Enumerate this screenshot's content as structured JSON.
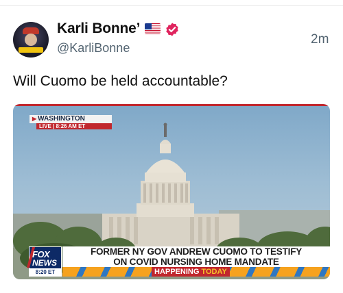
{
  "tweet": {
    "author": {
      "display_name": "Karli Bonne’",
      "handle": "@KarliBonne",
      "flag_emoji": "us-flag-icon",
      "verified": true,
      "verified_color": "#e0245e"
    },
    "timestamp": "2m",
    "text": "Will Cuomo be held accountable?"
  },
  "media": {
    "location_bug": {
      "city": "WASHINGTON",
      "live_line": "LIVE | 8:26 AM ET"
    },
    "network_logo": {
      "line1": "FOX",
      "line2": "NEWS",
      "time": "8:20 ET"
    },
    "headline": {
      "line1": "FORMER NY GOV ANDREW CUOMO TO TESTIFY",
      "line2": "ON COVID NURSING HOME MANDATE"
    },
    "ticker": {
      "tag": "HAPPENING",
      "tag_highlight": "TODAY"
    }
  },
  "colors": {
    "accent_red": "#c1272d",
    "fox_blue": "#0d2a66",
    "ticker_orange": "#f6a21e"
  }
}
